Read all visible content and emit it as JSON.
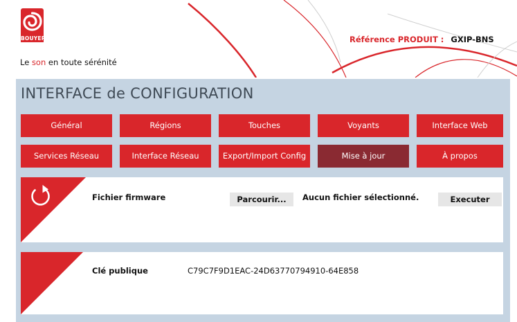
{
  "brand": {
    "logo_text": "BOUYER",
    "tagline_pre": "Le ",
    "tagline_accent": "son",
    "tagline_post": " en toute sérénité"
  },
  "reference": {
    "label": "Référence  PRODUIT :",
    "value": "GXIP-BNS"
  },
  "panel": {
    "title": "INTERFACE de CONFIGURATION"
  },
  "nav": {
    "row1": [
      "Général",
      "Régions",
      "Touches",
      "Voyants",
      "Interface Web"
    ],
    "row2": [
      "Services Réseau",
      "Interface Réseau",
      "Export/Import Config",
      "Mise à jour",
      "À propos"
    ],
    "active": "Mise à jour"
  },
  "firmware": {
    "label": "Fichier firmware",
    "browse_label": "Parcourir...",
    "file_status": "Aucun fichier sélectionné.",
    "execute_label": "Executer"
  },
  "public_key": {
    "label": "Clé publique",
    "value": "C79C7F9D1EAC-24D63770794910-64E858"
  },
  "colors": {
    "accent": "#d9262b",
    "active_tab": "#8a2a32",
    "panel_bg": "#c5d4e2"
  }
}
